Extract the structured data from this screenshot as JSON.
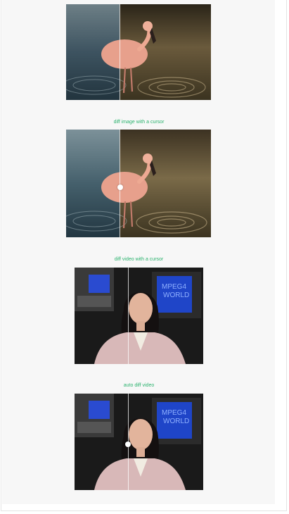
{
  "demos": {
    "image_cursor_caption": "diff image with a cursor",
    "video_cursor_caption": "diff video with a cursor",
    "auto_video_caption": "auto diff video"
  },
  "colors": {
    "caption": "#2db36f",
    "water_dark": "#22343e",
    "water_warm": "#3b3320",
    "flamingo": "#e7a08c",
    "studio_bg": "#1a1a1a",
    "monitor_blue": "#1f45c8",
    "jacket": "#d8b8b8",
    "hair": "#141010"
  },
  "icons": {
    "divider": "vertical-split-line",
    "cursor": "white-dot"
  }
}
